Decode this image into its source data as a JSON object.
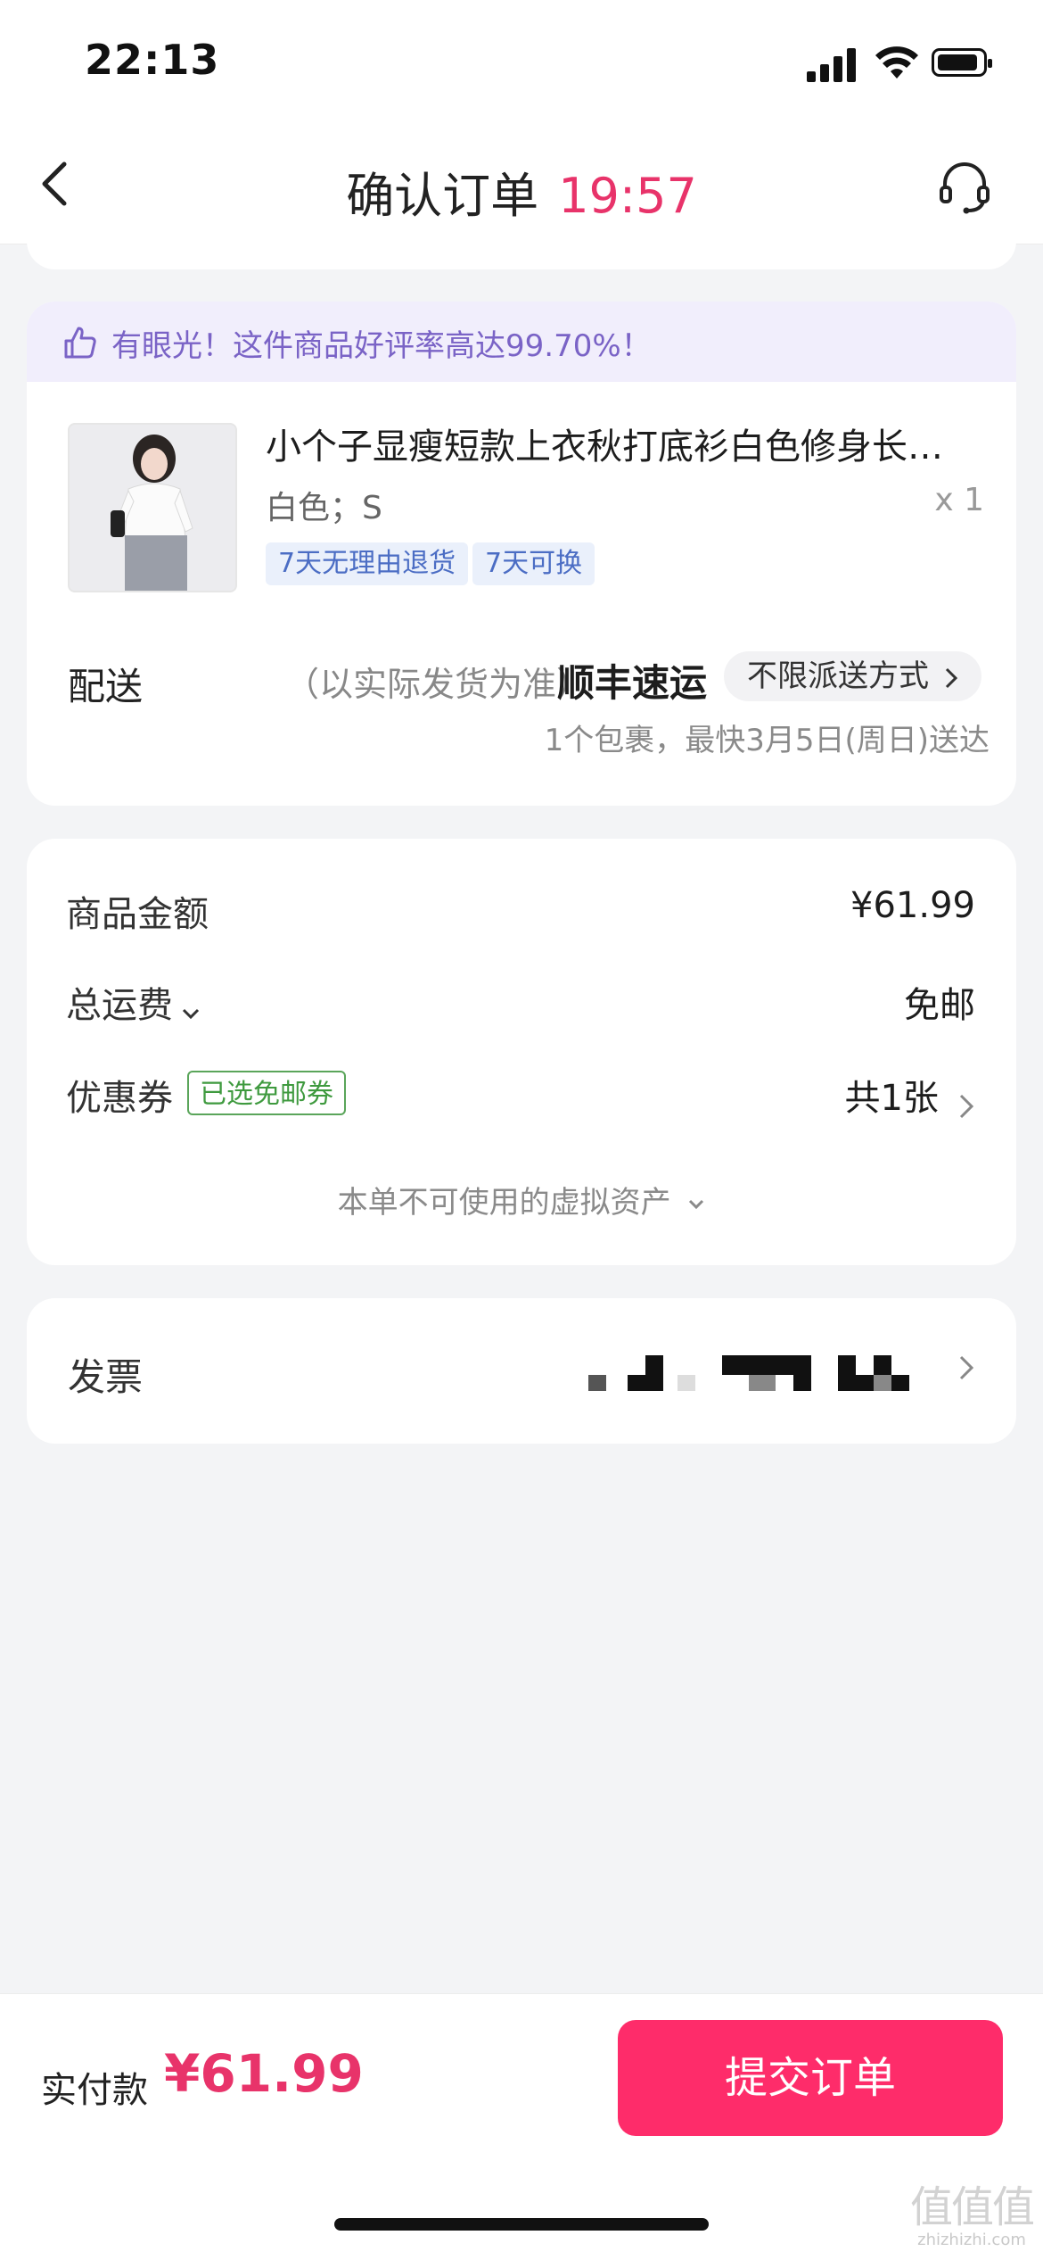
{
  "status_bar": {
    "time": "22:13"
  },
  "nav": {
    "title": "确认订单",
    "countdown": "19:57"
  },
  "praise_banner": {
    "text": "有眼光！这件商品好评率高达99.70%！"
  },
  "product": {
    "title": "小个子显瘦短款上衣秋打底衫白色修身长…",
    "spec": "白色；S",
    "quantity": "x 1",
    "tags": [
      "7天无理由退货",
      "7天可换"
    ]
  },
  "shipping": {
    "label": "配送",
    "note": "（以实际发货为准）",
    "carrier": "顺丰速运",
    "method": "不限派送方式",
    "eta": "1个包裹，最快3月5日(周日)送达"
  },
  "amounts": {
    "goods_label": "商品金额",
    "goods_value": "¥61.99",
    "shipping_label": "总运费",
    "shipping_value": "免邮",
    "coupon_label": "优惠券",
    "coupon_tag": "已选免邮券",
    "coupon_value": "共1张",
    "virtual_assets": "本单不可使用的虚拟资产"
  },
  "invoice": {
    "label": "发票"
  },
  "footer": {
    "pay_label": "实付款",
    "pay_amount": "¥61.99",
    "submit_label": "提交订单"
  },
  "watermark": {
    "top": "值值值",
    "bottom": "zhizhizhi.com"
  },
  "colors": {
    "accent": "#fe2c6a",
    "countdown": "#e8336a",
    "praise": "#7a63c6",
    "tag_blue": "#4b6dc4",
    "coupon_green": "#3f9a3f"
  }
}
